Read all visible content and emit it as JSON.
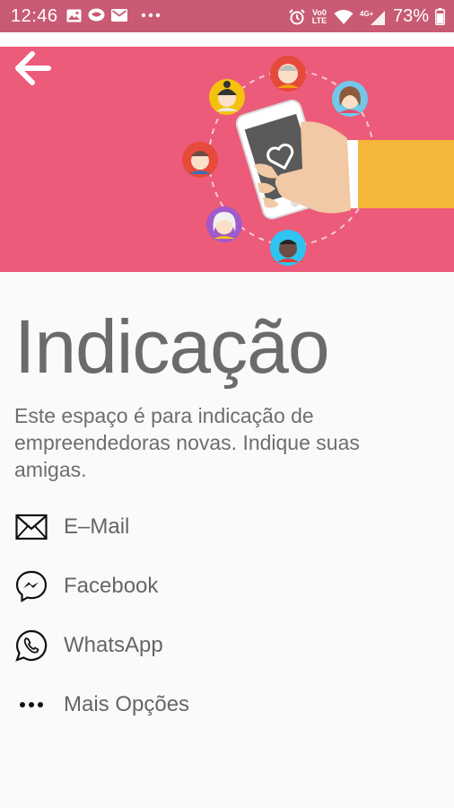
{
  "status_bar": {
    "time": "12:46",
    "battery": "73%",
    "left_icons": [
      "image-icon",
      "chat-bubble-icon",
      "email-icon",
      "more-dots-icon"
    ],
    "right_icons": [
      "alarm-icon",
      "volte-icon",
      "wifi-icon",
      "4g-signal-icon",
      "battery-icon"
    ],
    "volte_label": "Vo0 LTE",
    "network_label": "4G+"
  },
  "header": {
    "back_icon": "arrow-back-icon",
    "illustration": "phone-with-heart-and-contacts-illustration",
    "background_color": "#ec5b7a"
  },
  "page": {
    "title": "Indicação",
    "description": "Este espaço é para indicação de empreendedoras novas. Indique suas amigas."
  },
  "share_options": [
    {
      "label": "E–Mail",
      "icon": "email-envelope-icon"
    },
    {
      "label": "Facebook",
      "icon": "messenger-icon"
    },
    {
      "label": "WhatsApp",
      "icon": "whatsapp-icon"
    },
    {
      "label": "Mais Opções",
      "icon": "more-options-icon"
    }
  ]
}
